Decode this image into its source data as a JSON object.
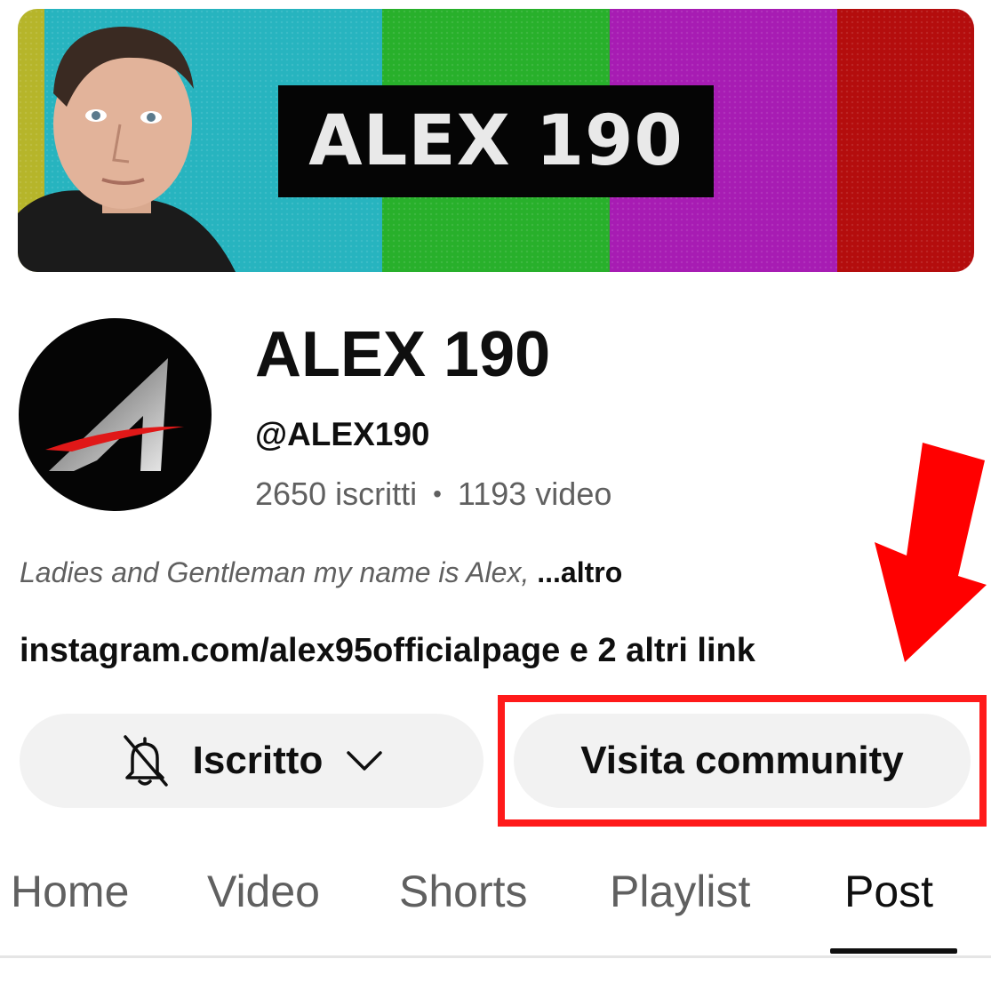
{
  "banner": {
    "title": "ALEX 190"
  },
  "channel": {
    "name": "ALEX 190",
    "handle": "@ALEX190",
    "subscribers": "2650 iscritti",
    "separator": "•",
    "videos": "1193 video",
    "description": "Ladies and Gentleman my name is Alex,",
    "description_more": " ...altro",
    "links": "instagram.com/alex95officialpage e 2 altri link"
  },
  "buttons": {
    "subscribed_label": "Iscritto",
    "community_label": "Visita community"
  },
  "tabs": [
    {
      "label": "Home"
    },
    {
      "label": "Video"
    },
    {
      "label": "Shorts"
    },
    {
      "label": "Playlist"
    },
    {
      "label": "Post",
      "active": true
    }
  ],
  "colors": {
    "annotation": "#ff1a1a",
    "button_bg": "#f2f2f2",
    "secondary_text": "#606060"
  },
  "icons": {
    "bell": "bell-off-icon",
    "chevron": "chevron-down-icon",
    "annotation_arrow": "arrow-down-icon"
  }
}
